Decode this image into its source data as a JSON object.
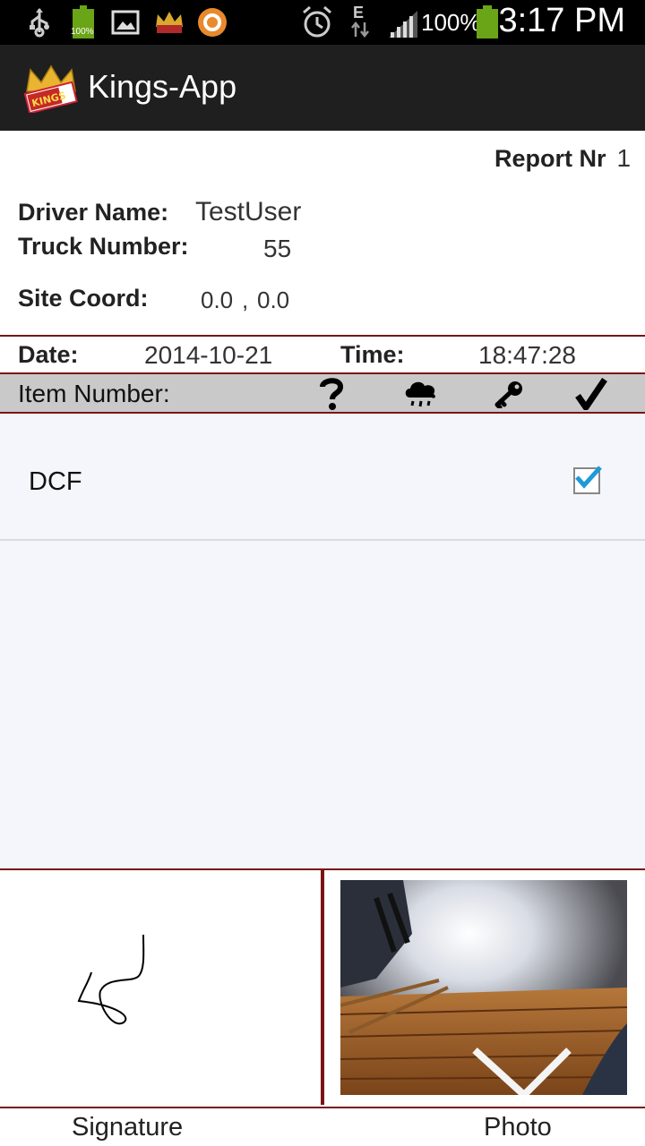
{
  "status_bar": {
    "battery_small_label": "100%",
    "battery_percent": "100%",
    "network_type": "E",
    "time": "3:17 PM"
  },
  "action_bar": {
    "app_title": "Kings-App",
    "logo_text": "KINGS"
  },
  "report": {
    "report_label": "Report Nr",
    "report_number": "1",
    "driver_label": "Driver Name:",
    "driver_value": "TestUser",
    "truck_label": "Truck Number:",
    "truck_value": "55",
    "site_label": "Site Coord:",
    "site_lat": "0.0",
    "site_sep": ",",
    "site_lon": "0.0",
    "date_label": "Date:",
    "date_value": "2014-10-21",
    "time_label": "Time:",
    "time_value": "18:47:28"
  },
  "list_header": {
    "item_number_label": "Item Number:",
    "icons": [
      "question-icon",
      "rain-cloud-icon",
      "key-icon",
      "checkmark-icon"
    ]
  },
  "items": [
    {
      "name": "DCF",
      "checked": true
    }
  ],
  "footer": {
    "signature_label": "Signature",
    "photo_label": "Photo"
  },
  "colors": {
    "accent_line": "#7a1414",
    "checkbox_check": "#1e9bd7",
    "battery_green": "#6aa417"
  }
}
